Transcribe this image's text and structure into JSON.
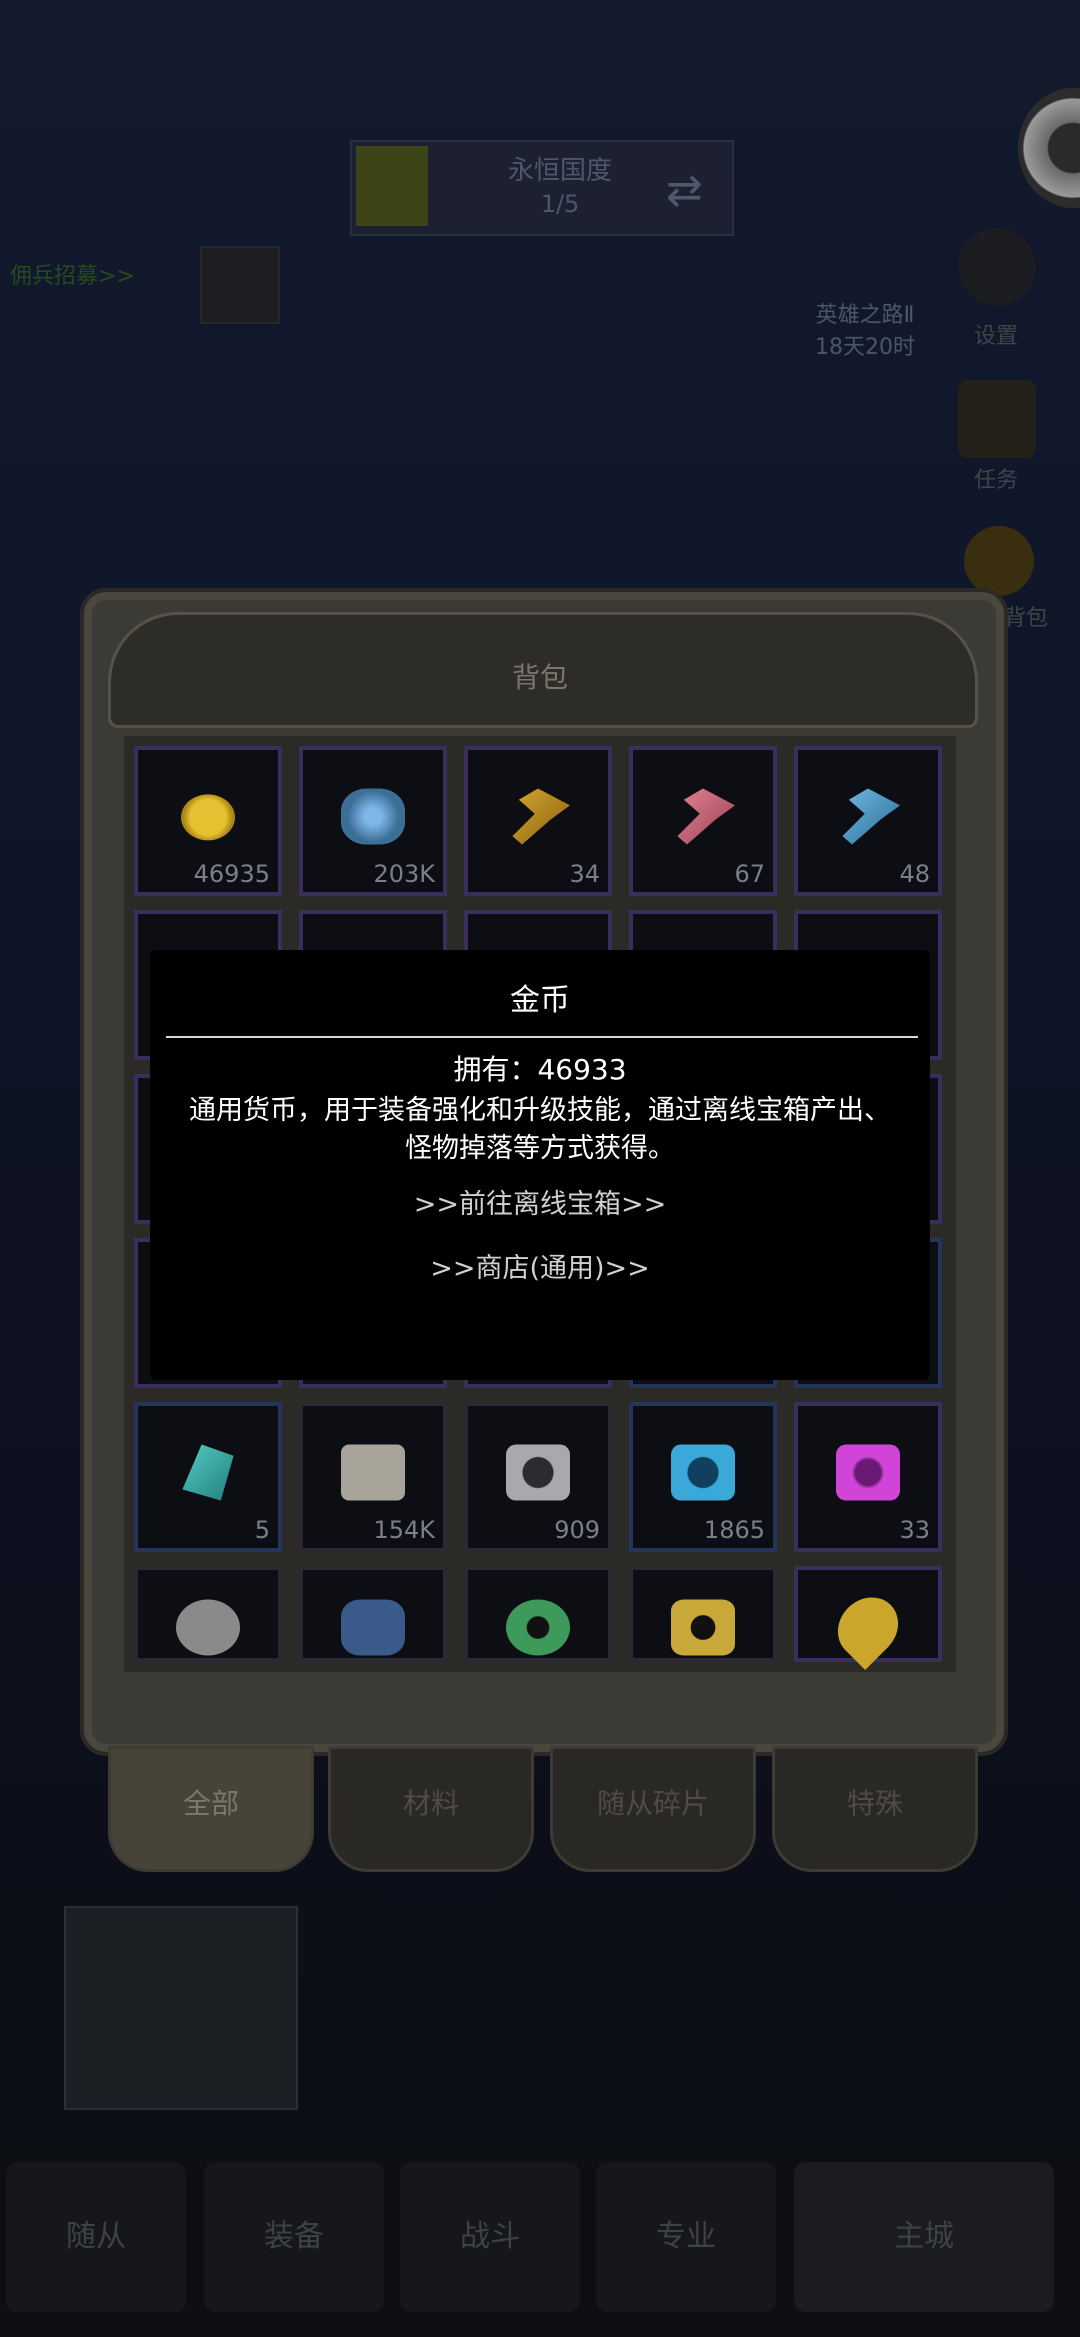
{
  "stage": {
    "name": "永恒国度",
    "progress": "1/5"
  },
  "hud": {
    "left_link": "佣兵招募>>",
    "hero_road_title": "英雄之路Ⅱ",
    "hero_road_time": "18天20时",
    "side_settings": "设置",
    "side_task": "任务",
    "side_bag": "背包"
  },
  "bag": {
    "title": "背包",
    "rows": [
      [
        {
          "icon": "gold-coin-icon",
          "count": "46935",
          "rarity": "purple"
        },
        {
          "icon": "blue-gem-icon",
          "count": "203K",
          "rarity": "purple"
        },
        {
          "icon": "gold-key-icon",
          "count": "34",
          "rarity": "purple"
        },
        {
          "icon": "pink-key-icon",
          "count": "67",
          "rarity": "purple"
        },
        {
          "icon": "blue-key-icon",
          "count": "48",
          "rarity": "purple"
        }
      ],
      [
        {
          "icon": "",
          "count": "",
          "rarity": "purple"
        },
        {
          "icon": "",
          "count": "",
          "rarity": "purple"
        },
        {
          "icon": "",
          "count": "",
          "rarity": "purple"
        },
        {
          "icon": "",
          "count": "",
          "rarity": "purple"
        },
        {
          "icon": "",
          "count": "",
          "rarity": "purple"
        }
      ],
      [
        {
          "icon": "",
          "count": "",
          "rarity": "purple"
        },
        {
          "icon": "",
          "count": "",
          "rarity": "purple"
        },
        {
          "icon": "",
          "count": "",
          "rarity": "purple"
        },
        {
          "icon": "",
          "count": "",
          "rarity": "purple"
        },
        {
          "icon": "",
          "count": "",
          "rarity": "purple"
        }
      ],
      [
        {
          "icon": "",
          "count": "",
          "rarity": "purple"
        },
        {
          "icon": "",
          "count": "",
          "rarity": "purple"
        },
        {
          "icon": "",
          "count": "",
          "rarity": "purple"
        },
        {
          "icon": "",
          "count": "",
          "rarity": "blue"
        },
        {
          "icon": "",
          "count": "",
          "rarity": "blue"
        }
      ],
      [
        {
          "icon": "teal-crystal-icon",
          "count": "5",
          "rarity": "blue"
        },
        {
          "icon": "scroll-icon",
          "count": "154K",
          "rarity": "gray"
        },
        {
          "icon": "gray-puzzle-icon",
          "count": "909",
          "rarity": "gray"
        },
        {
          "icon": "blue-puzzle-icon",
          "count": "1865",
          "rarity": "blue"
        },
        {
          "icon": "purple-puzzle-icon",
          "count": "33",
          "rarity": "purple"
        }
      ],
      [
        {
          "icon": "white-ore-icon",
          "count": "",
          "rarity": "gray"
        },
        {
          "icon": "blue-bag-icon",
          "count": "",
          "rarity": "gray"
        },
        {
          "icon": "green-token-icon",
          "count": "",
          "rarity": "gray"
        },
        {
          "icon": "gold-ring-icon",
          "count": "",
          "rarity": "gray"
        },
        {
          "icon": "gold-drop-icon",
          "count": "",
          "rarity": "purple"
        }
      ]
    ],
    "tabs": [
      "全部",
      "材料",
      "随从碎片",
      "特殊"
    ]
  },
  "bottom_nav": [
    "随从",
    "装备",
    "战斗",
    "专业",
    "主城"
  ],
  "tooltip": {
    "title": "金币",
    "own_label": "拥有：46933",
    "description": "通用货币，用于装备强化和升级技能，通过离线宝箱产出、怪物掉落等方式获得。",
    "link1": ">>前往离线宝箱>>",
    "link2": ">>商店(通用)>>"
  },
  "colors": {
    "gold": "#c9a01e",
    "purple_border": "#3a2f5c",
    "blue_border": "#24345a",
    "tooltip_bg": "#000000"
  }
}
